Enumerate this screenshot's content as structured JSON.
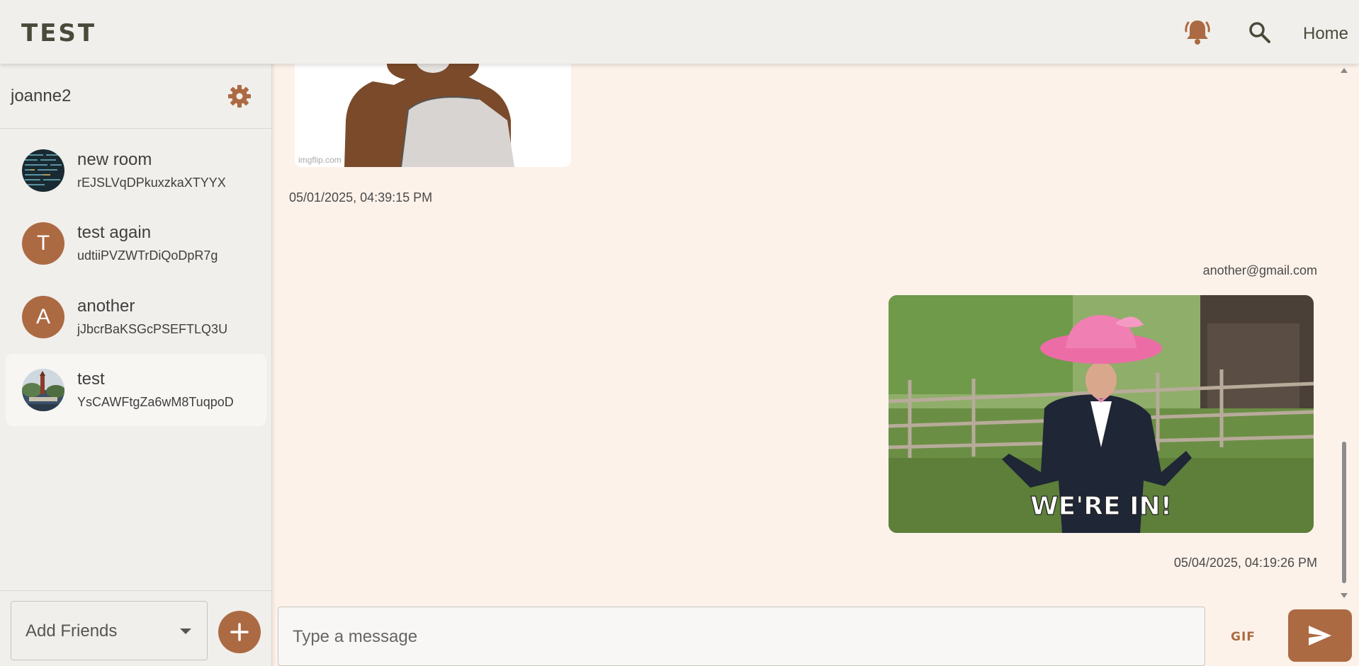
{
  "header": {
    "logo": "TEST",
    "home_label": "Home",
    "notification_icon": "bell-icon",
    "search_icon": "search-icon"
  },
  "sidebar": {
    "username": "joanne2",
    "settings_icon": "gear-icon",
    "rooms": [
      {
        "name": "new room",
        "id": "rEJSLVqDPkuxzkaXTYYX",
        "avatar": "code-image"
      },
      {
        "name": "test again",
        "id": "udtiiPVZWTrDiQoDpR7g",
        "avatar_letter": "T"
      },
      {
        "name": "another",
        "id": "jJbcrBaKSGcPSEFTLQ3U",
        "avatar_letter": "A"
      },
      {
        "name": "test",
        "id": "YsCAWFtgZa6wM8TuqpoD",
        "avatar": "landscape-image",
        "active": true
      }
    ],
    "add_friends_label": "Add Friends",
    "add_icon": "plus-icon"
  },
  "messages": [
    {
      "type": "image",
      "image_watermark": "imgflip.com",
      "timestamp": "05/01/2025, 04:39:15 PM",
      "align": "left"
    },
    {
      "type": "image",
      "sender": "another@gmail.com",
      "image_caption": "WE'RE IN!",
      "timestamp": "05/04/2025, 04:19:26 PM",
      "align": "right"
    }
  ],
  "composer": {
    "placeholder": "Type a message",
    "gif_label": "GIF",
    "send_icon": "send-icon"
  },
  "colors": {
    "accent": "#ac6a43",
    "chat_bg": "#fdf2ea",
    "sidebar_bg": "#f0efeb"
  }
}
